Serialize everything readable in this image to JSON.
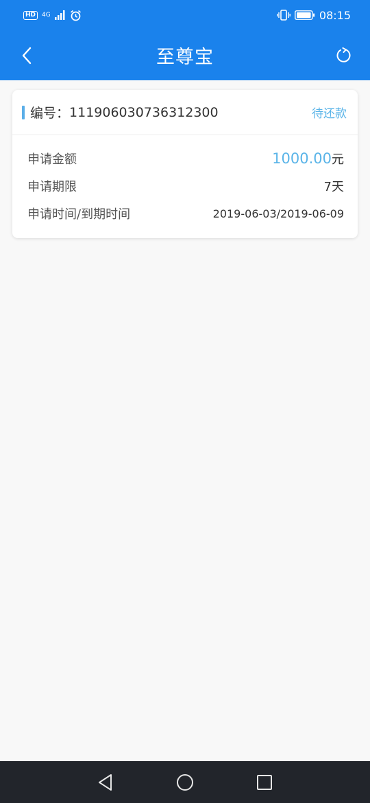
{
  "status_bar": {
    "hd": "HD",
    "net_type": "4G",
    "time": "08:15",
    "icons": [
      "signal-icon",
      "alarm-icon",
      "vibrate-icon",
      "battery-icon"
    ]
  },
  "header": {
    "title": "至尊宝",
    "back_icon": "chevron-left-icon",
    "refresh_icon": "refresh-icon",
    "color": "#1a82ec"
  },
  "order": {
    "number_label": "编号：",
    "number": "111906030736312300",
    "status": "待还款",
    "rows": [
      {
        "label": "申请金额",
        "value": "1000.00",
        "unit": "元"
      },
      {
        "label": "申请期限",
        "value": "7天"
      },
      {
        "label": "申请时间/到期时间",
        "value": "2019-06-03/2019-06-09"
      }
    ],
    "accent_color": "#5ab4e8"
  },
  "nav": {
    "icons": [
      "back-triangle-icon",
      "home-circle-icon",
      "recents-square-icon"
    ]
  }
}
